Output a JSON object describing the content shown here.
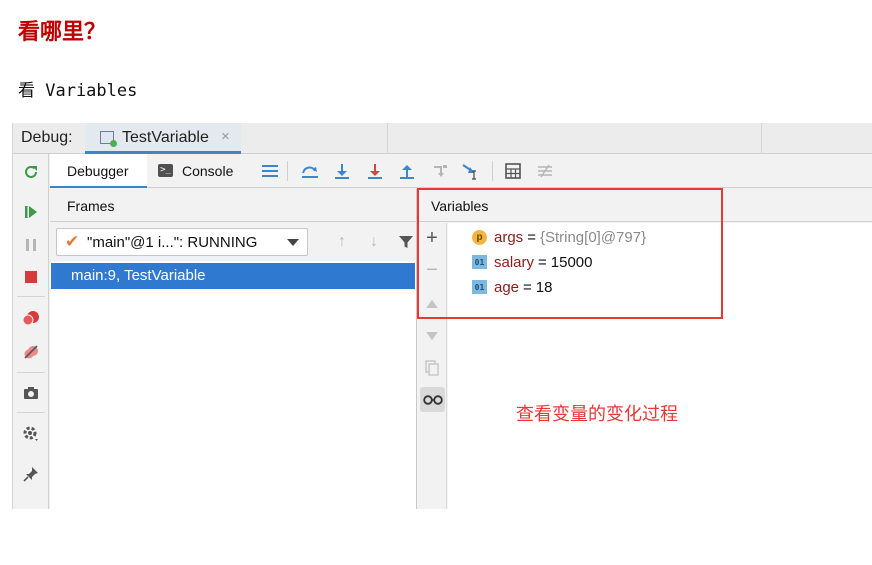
{
  "heading": "看哪里？",
  "subline": "看 Variables",
  "debug_window": {
    "label": "Debug:",
    "tab": {
      "label": "TestVariable",
      "close": "×"
    }
  },
  "left_toolbar": {
    "icons": [
      "rerun-icon",
      "resume-icon",
      "pause-icon",
      "stop-icon",
      "view-breakpoints-icon",
      "mute-breakpoints-icon",
      "camera-icon",
      "settings-icon",
      "pin-icon"
    ]
  },
  "toolbar": {
    "tabs": [
      "Debugger",
      "Console"
    ],
    "colors": {
      "step_blue": "#3a86cf",
      "step_red": "#d64545",
      "accent": "#4083c9"
    }
  },
  "frames": {
    "header": "Frames",
    "thread": "\"main\"@1 i...\": RUNNING",
    "items": [
      "main:9, TestVariable"
    ]
  },
  "variables": {
    "header": "Variables",
    "items": [
      {
        "badge": "p",
        "name": "args",
        "eq": "=",
        "value": "{String[0]@797}"
      },
      {
        "badge": "01",
        "name": "salary",
        "eq": "=",
        "value": "15000"
      },
      {
        "badge": "01",
        "name": "age",
        "eq": "=",
        "value": "18"
      }
    ]
  },
  "annotation": "查看变量的变化过程",
  "colors": {
    "heading": "#c00000",
    "annotation": "#e53935",
    "selection": "#2f79d1"
  }
}
